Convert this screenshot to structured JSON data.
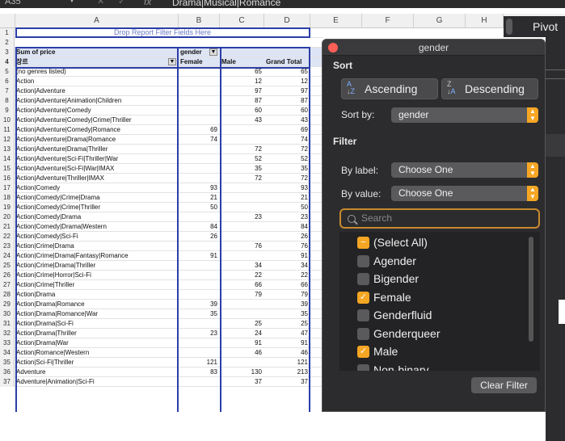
{
  "formula_bar": {
    "cell_ref": "A35",
    "fx": "fx",
    "value": "Drama|Musical|Romance",
    "cancel": "✕",
    "confirm": "✓",
    "dropdown": "▼"
  },
  "columns": [
    "A",
    "B",
    "C",
    "D",
    "E",
    "F",
    "G",
    "H"
  ],
  "pivot": {
    "filter_drop": "Drop Report Filter Fields Here",
    "sum_label": "Sum of price",
    "col_field": "gender",
    "row_field": "장르",
    "header_female": "Female",
    "header_male": "Male",
    "header_total": "Grand Total"
  },
  "rows": [
    {
      "n": "5",
      "a": "(no genres listed)",
      "b": "",
      "c": "65",
      "d": "65"
    },
    {
      "n": "6",
      "a": "Action",
      "b": "",
      "c": "12",
      "d": "12"
    },
    {
      "n": "7",
      "a": "Action|Adventure",
      "b": "",
      "c": "97",
      "d": "97"
    },
    {
      "n": "8",
      "a": "Action|Adventure|Animation|Children",
      "b": "",
      "c": "87",
      "d": "87"
    },
    {
      "n": "9",
      "a": "Action|Adventure|Comedy",
      "b": "",
      "c": "60",
      "d": "60"
    },
    {
      "n": "10",
      "a": "Action|Adventure|Comedy|Crime|Thriller",
      "b": "",
      "c": "43",
      "d": "43"
    },
    {
      "n": "11",
      "a": "Action|Adventure|Comedy|Romance",
      "b": "69",
      "c": "",
      "d": "69"
    },
    {
      "n": "12",
      "a": "Action|Adventure|Drama|Romance",
      "b": "74",
      "c": "",
      "d": "74"
    },
    {
      "n": "13",
      "a": "Action|Adventure|Drama|Thriller",
      "b": "",
      "c": "72",
      "d": "72"
    },
    {
      "n": "14",
      "a": "Action|Adventure|Sci-Fi|Thriller|War",
      "b": "",
      "c": "52",
      "d": "52"
    },
    {
      "n": "15",
      "a": "Action|Adventure|Sci-Fi|War|IMAX",
      "b": "",
      "c": "35",
      "d": "35"
    },
    {
      "n": "16",
      "a": "Action|Adventure|Thriller|IMAX",
      "b": "",
      "c": "72",
      "d": "72"
    },
    {
      "n": "17",
      "a": "Action|Comedy",
      "b": "93",
      "c": "",
      "d": "93"
    },
    {
      "n": "18",
      "a": "Action|Comedy|Crime|Drama",
      "b": "21",
      "c": "",
      "d": "21"
    },
    {
      "n": "19",
      "a": "Action|Comedy|Crime|Thriller",
      "b": "50",
      "c": "",
      "d": "50"
    },
    {
      "n": "20",
      "a": "Action|Comedy|Drama",
      "b": "",
      "c": "23",
      "d": "23"
    },
    {
      "n": "21",
      "a": "Action|Comedy|Drama|Western",
      "b": "84",
      "c": "",
      "d": "84"
    },
    {
      "n": "22",
      "a": "Action|Comedy|Sci-Fi",
      "b": "26",
      "c": "",
      "d": "26"
    },
    {
      "n": "23",
      "a": "Action|Crime|Drama",
      "b": "",
      "c": "76",
      "d": "76"
    },
    {
      "n": "24",
      "a": "Action|Crime|Drama|Fantasy|Romance",
      "b": "91",
      "c": "",
      "d": "91"
    },
    {
      "n": "25",
      "a": "Action|Crime|Drama|Thriller",
      "b": "",
      "c": "34",
      "d": "34"
    },
    {
      "n": "26",
      "a": "Action|Crime|Horror|Sci-Fi",
      "b": "",
      "c": "22",
      "d": "22"
    },
    {
      "n": "27",
      "a": "Action|Crime|Thriller",
      "b": "",
      "c": "66",
      "d": "66"
    },
    {
      "n": "28",
      "a": "Action|Drama",
      "b": "",
      "c": "79",
      "d": "79"
    },
    {
      "n": "29",
      "a": "Action|Drama|Romance",
      "b": "39",
      "c": "",
      "d": "39"
    },
    {
      "n": "30",
      "a": "Action|Drama|Romance|War",
      "b": "35",
      "c": "",
      "d": "35"
    },
    {
      "n": "31",
      "a": "Action|Drama|Sci-Fi",
      "b": "",
      "c": "25",
      "d": "25"
    },
    {
      "n": "32",
      "a": "Action|Drama|Thriller",
      "b": "23",
      "c": "24",
      "d": "47"
    },
    {
      "n": "33",
      "a": "Action|Drama|War",
      "b": "",
      "c": "91",
      "d": "91"
    },
    {
      "n": "34",
      "a": "Action|Romance|Western",
      "b": "",
      "c": "46",
      "d": "46"
    },
    {
      "n": "35",
      "a": "Action|Sci-Fi|Thriller",
      "b": "121",
      "c": "",
      "d": "121"
    },
    {
      "n": "36",
      "a": "Adventure",
      "b": "83",
      "c": "130",
      "d": "213"
    },
    {
      "n": "37",
      "a": "Adventure|Animation|Sci-Fi",
      "b": "",
      "c": "37",
      "d": "37"
    }
  ],
  "panel": {
    "title": "gender",
    "sort_heading": "Sort",
    "ascending": "Ascending",
    "descending": "Descending",
    "sort_by_label": "Sort by:",
    "sort_by_value": "gender",
    "filter_heading": "Filter",
    "by_label": "By label:",
    "by_label_value": "Choose One",
    "by_value": "By value:",
    "by_value_value": "Choose One",
    "search_placeholder": "Search",
    "items": [
      {
        "label": "(Select All)",
        "state": "partial"
      },
      {
        "label": "Agender",
        "state": "off"
      },
      {
        "label": "Bigender",
        "state": "off"
      },
      {
        "label": "Female",
        "state": "on"
      },
      {
        "label": "Genderfluid",
        "state": "off"
      },
      {
        "label": "Genderqueer",
        "state": "off"
      },
      {
        "label": "Male",
        "state": "on"
      },
      {
        "label": "Non-binary",
        "state": "off"
      }
    ],
    "clear_filter": "Clear Filter"
  },
  "right_panel": {
    "title": "Pivot"
  },
  "colors": {
    "accent": "#f5a623",
    "panel_bg": "#2c2c2e",
    "pivot_border": "#2b3ea8"
  }
}
